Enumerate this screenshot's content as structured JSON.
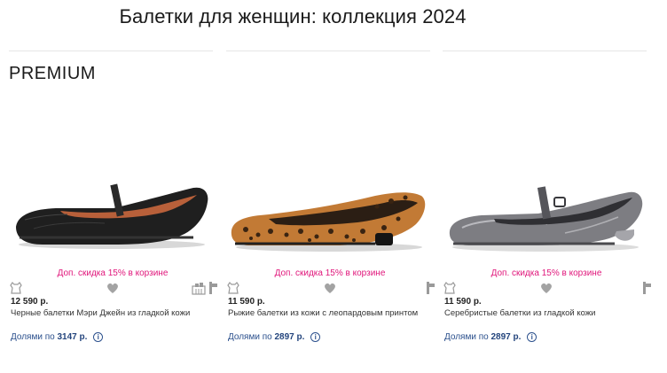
{
  "page": {
    "title": "Балетки для женщин: коллекция 2024",
    "section_label": "PREMIUM"
  },
  "colors": {
    "promo": "#e0157a",
    "installment": "#2a4f8c"
  },
  "products": [
    {
      "promo": "Доп. скидка 15% в корзине",
      "price": "12 590 р.",
      "name": "Черные балетки Мэри Джейн из гладкой кожи",
      "installment_prefix": "Долями по",
      "installment_amount": "3147 р.",
      "icons": [
        "leather-icon",
        "favorite-heart-icon",
        "store-availability-icon",
        "heel-height-icon"
      ]
    },
    {
      "promo": "Доп. скидка 15% в корзине",
      "price": "11 590 р.",
      "name": "Рыжие балетки из кожи с леопардовым принтом",
      "installment_prefix": "Долями по",
      "installment_amount": "2897 р.",
      "icons": [
        "leather-icon",
        "favorite-heart-icon",
        "heel-height-icon"
      ]
    },
    {
      "promo": "Доп. скидка 15% в корзине",
      "price": "11 590 р.",
      "name": "Серебристые балетки из гладкой кожи",
      "installment_prefix": "Долями по",
      "installment_amount": "2897 р.",
      "icons": [
        "leather-icon",
        "favorite-heart-icon",
        "heel-height-icon"
      ]
    }
  ]
}
